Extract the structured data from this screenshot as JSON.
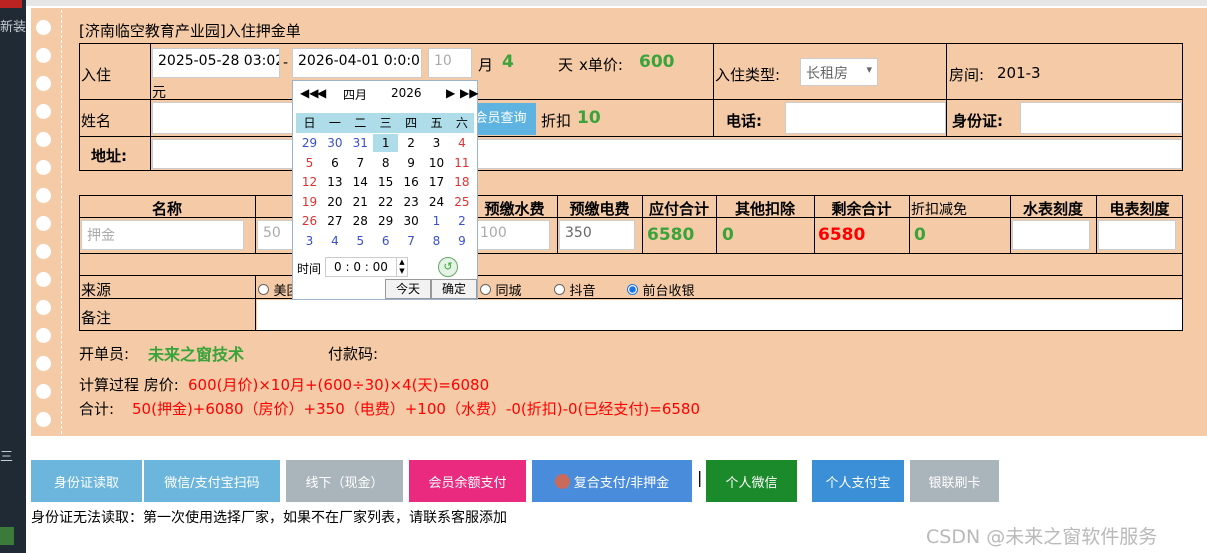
{
  "title": "[济南临空教育产业园]入住押金单",
  "row1": {
    "label": "入住",
    "start_date": "2025-05-28 03:02",
    "dash": "-",
    "end_date": "2026-04-01 0:0:0",
    "months_value": "10",
    "month_unit": "月",
    "days": "4",
    "day_unit": "天",
    "price_label": "x单价:",
    "price": "600",
    "yuan": "元",
    "type_label": "入住类型:",
    "type_value": "长租房",
    "room_label": "房间:",
    "room_value": "201-3"
  },
  "row2": {
    "name_label": "姓名",
    "member_query": "会员查询",
    "discount_label": "折扣",
    "discount_value": "10",
    "phone_label": "电话:",
    "id_label": "身份证:"
  },
  "row3": {
    "address_label": "地址:"
  },
  "fees": {
    "headers": [
      "名称",
      "预缴水费",
      "预缴电费",
      "应付合计",
      "其他扣除",
      "剩余合计",
      "折扣减免",
      "水表刻度",
      "电表刻度"
    ],
    "name_placeholder": "押金",
    "deposit": "50",
    "water_fee": "100",
    "elec_fee": "350",
    "total_payable": "6580",
    "other_deduct": "0",
    "remaining": "6580",
    "discount_reduce": "0"
  },
  "source": {
    "label": "来源",
    "options": [
      "美团",
      "同城",
      "抖音",
      "前台收银"
    ],
    "selected": "前台收银"
  },
  "remark_label": "备注",
  "operator_label": "开单员:",
  "operator_value": "未来之窗技术",
  "paycode_label": "付款码:",
  "calc": {
    "label": "计算过程 房价:",
    "formula": "600(月价)×10月+(600÷30)×4(天)=6080",
    "total_label": "合计:",
    "total_formula": "50(押金)+6080（房价）+350（电费）+100（水费）-0(折扣)-0(已经支付)=6580"
  },
  "calendar": {
    "month": "四月",
    "year": "2026",
    "weekdays": [
      "日",
      "一",
      "二",
      "三",
      "四",
      "五",
      "六"
    ],
    "weeks": [
      [
        "29",
        "30",
        "31",
        "1",
        "2",
        "3",
        "4"
      ],
      [
        "5",
        "6",
        "7",
        "8",
        "9",
        "10",
        "11"
      ],
      [
        "12",
        "13",
        "14",
        "15",
        "16",
        "17",
        "18"
      ],
      [
        "19",
        "20",
        "21",
        "22",
        "23",
        "24",
        "25"
      ],
      [
        "26",
        "27",
        "28",
        "29",
        "30",
        "1",
        "2"
      ],
      [
        "3",
        "4",
        "5",
        "6",
        "7",
        "8",
        "9"
      ]
    ],
    "time_label": "时间",
    "time_value": "0 : 0 : 00",
    "today": "今天",
    "confirm": "确定"
  },
  "buttons": [
    {
      "label": "身份证读取",
      "color": "#6cb6de"
    },
    {
      "label": "微信/支付宝扫码",
      "color": "#6cb6de"
    },
    {
      "label": "线下（现金）",
      "color": "#aab4bb"
    },
    {
      "label": "会员余额支付",
      "color": "#ea2a7f"
    },
    {
      "label": "复合支付/非押金",
      "color": "#4a8cdc"
    },
    {
      "label": "个人微信",
      "color": "#1a8a2a"
    },
    {
      "label": "个人支付宝",
      "color": "#3a8fd6"
    },
    {
      "label": "银联刷卡",
      "color": "#aab4bb"
    }
  ],
  "separator": "|",
  "footer_note": "身份证无法读取：第一次使用选择厂家，如果不在厂家列表，请联系客服添加",
  "watermark": "CSDN @未来之窗软件服务",
  "left_panel": {
    "text_top": "新装",
    "text_mid": "三"
  }
}
